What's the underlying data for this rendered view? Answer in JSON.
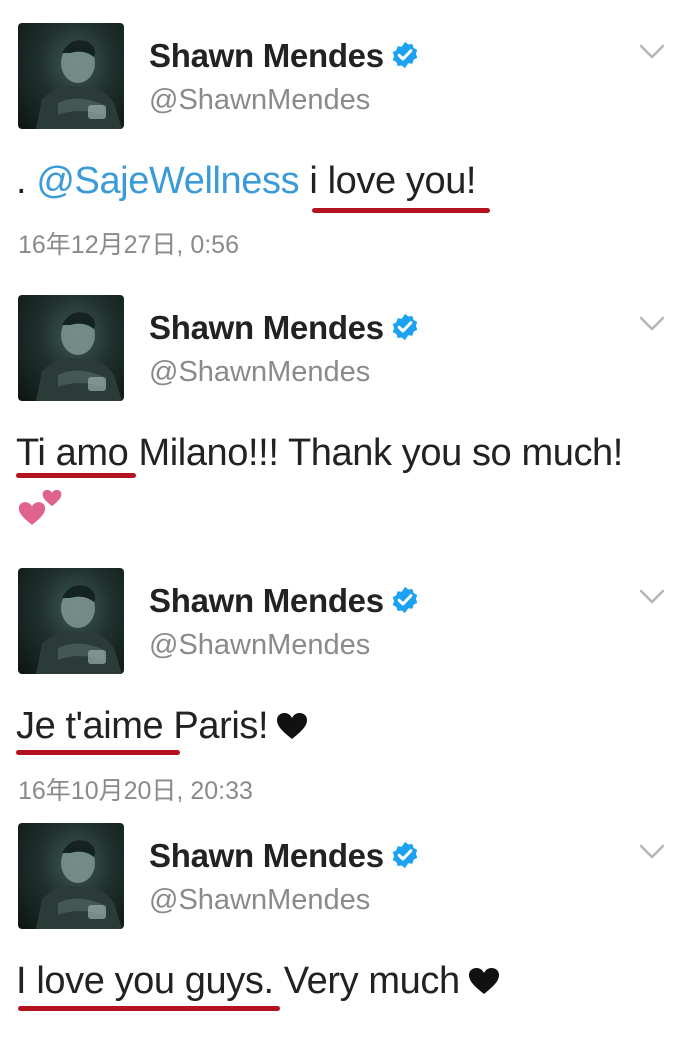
{
  "tweets": [
    {
      "name": "Shawn Mendes",
      "handle": "@ShawnMendes",
      "text_prefix": ". ",
      "mention": "@SajeWellness",
      "text_main": " i love you!",
      "timestamp": "16年12月27日, 0:56"
    },
    {
      "name": "Shawn Mendes",
      "handle": "@ShawnMendes",
      "text_main": "Ti amo Milano!!! Thank you so much!",
      "emoji": "two-hearts"
    },
    {
      "name": "Shawn Mendes",
      "handle": "@ShawnMendes",
      "text_main": "Je t'aime Paris!",
      "emoji": "black-heart",
      "timestamp": "16年10月20日, 20:33"
    },
    {
      "name": "Shawn Mendes",
      "handle": "@ShawnMendes",
      "text_main": "I love you guys. Very much",
      "emoji": "black-heart"
    }
  ],
  "colors": {
    "mention": "#3b9bd8",
    "verified": "#1da1f2",
    "underline": "#b3131e",
    "heart_pink": "#e0628f"
  }
}
